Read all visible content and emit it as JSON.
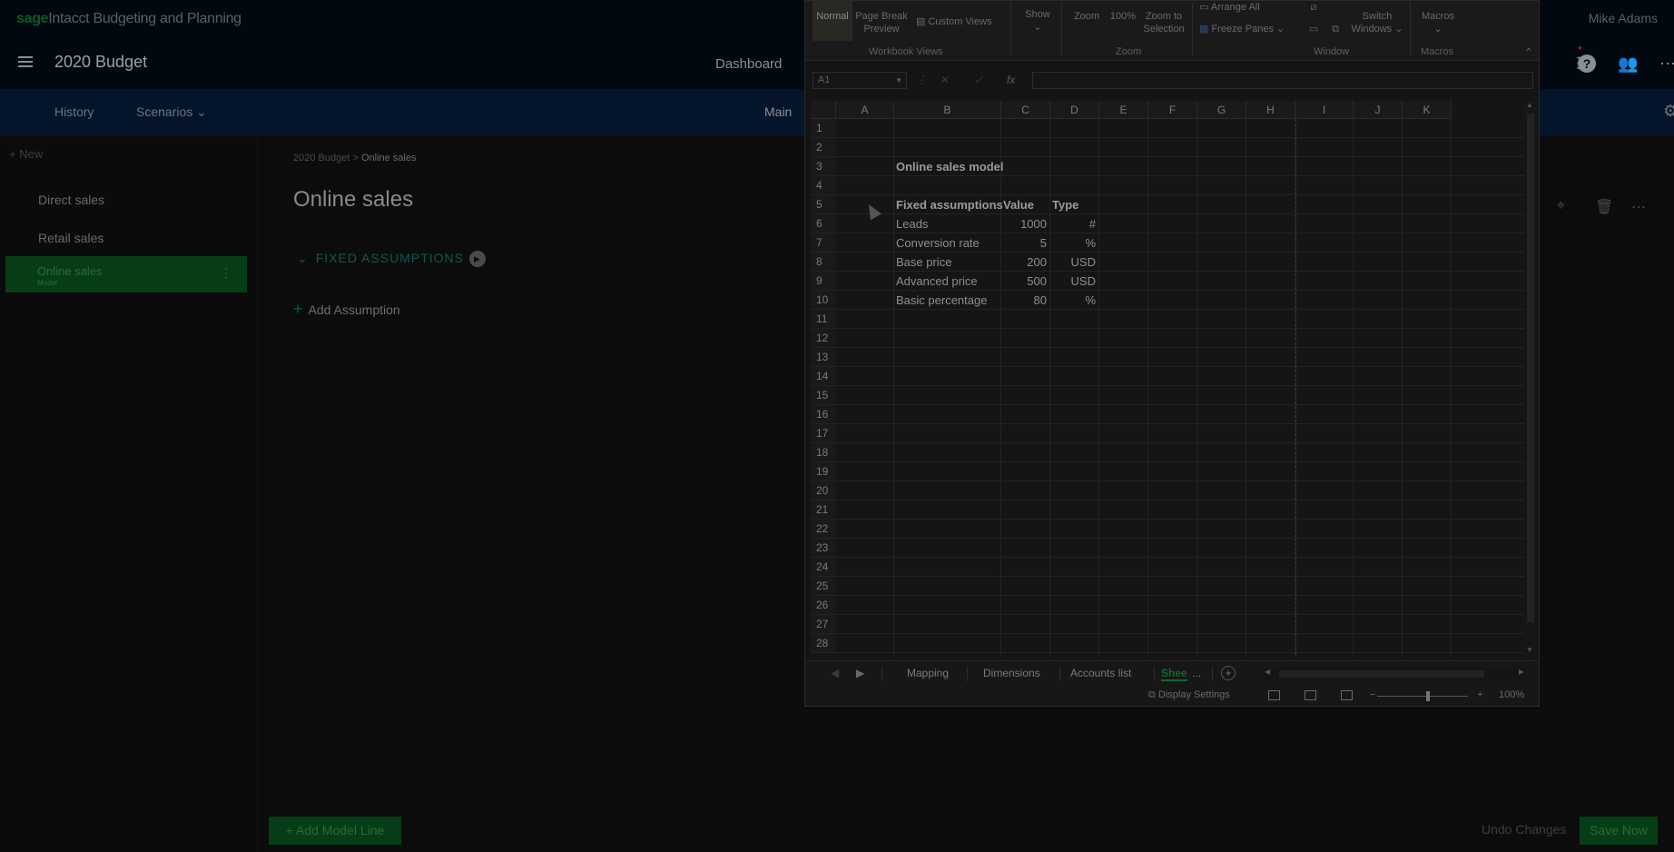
{
  "app": {
    "brand_sage": "sage",
    "brand_rest": "Intacct Budgeting and Planning",
    "user": "Mike Adams",
    "title": "2020 Budget",
    "nav_dashboard": "Dashboard"
  },
  "subnav": {
    "history": "History",
    "scenarios": "Scenarios",
    "main": "Main"
  },
  "sidebar": {
    "new_label": "+ New",
    "items": [
      "Direct sales",
      "Retail sales"
    ],
    "active": {
      "label": "Online sales",
      "sub": "Model"
    }
  },
  "main": {
    "breadcrumb_root": "2020 Budget",
    "breadcrumb_sep": ">",
    "breadcrumb_current": "Online sales",
    "title": "Online sales",
    "section": "FIXED ASSUMPTIONS",
    "add_assumption": "Add Assumption",
    "add_model_line": "+ Add Model Line",
    "undo": "Undo Changes",
    "save": "Save Now"
  },
  "excel": {
    "ribbon": {
      "normal": "Normal",
      "page_break_1": "Page Break",
      "page_break_2": "Preview",
      "custom_views": "Custom Views",
      "workbook_views": "Workbook Views",
      "show": "Show",
      "zoom": "Zoom",
      "zoom_100": "100%",
      "zoom_sel_1": "Zoom to",
      "zoom_sel_2": "Selection",
      "zoom_group": "Zoom",
      "arrange_all": "Arrange All",
      "freeze_panes": "Freeze Panes",
      "switch_1": "Switch",
      "switch_2": "Windows",
      "window_group": "Window",
      "macros": "Macros",
      "macros_group": "Macros"
    },
    "name_box": "A1",
    "fx": "fx",
    "columns": [
      "A",
      "B",
      "C",
      "D",
      "E",
      "F",
      "G",
      "H",
      "I",
      "J",
      "K"
    ],
    "rows": [
      "1",
      "2",
      "3",
      "4",
      "5",
      "6",
      "7",
      "8",
      "9",
      "10",
      "11",
      "12",
      "13",
      "14",
      "15",
      "16",
      "17",
      "18",
      "19",
      "20",
      "21",
      "22",
      "23",
      "24",
      "25",
      "26",
      "27",
      "28"
    ],
    "sheet_title": "Online sales model",
    "headers": {
      "name": "Fixed assumptions",
      "value": "Value",
      "type": "Type"
    },
    "assumptions": [
      {
        "name": "Leads",
        "value": "1000",
        "type": "#"
      },
      {
        "name": "Conversion rate",
        "value": "5",
        "type": "%"
      },
      {
        "name": "Base price",
        "value": "200",
        "type": "USD"
      },
      {
        "name": "Advanced price",
        "value": "500",
        "type": "USD"
      },
      {
        "name": "Basic percentage",
        "value": "80",
        "type": "%"
      }
    ],
    "tabs": [
      "Mapping",
      "Dimensions",
      "Accounts list"
    ],
    "active_tab": "Shee",
    "tab_ellipsis": "...",
    "display_settings": "Display Settings",
    "zoom_level": "100%"
  }
}
